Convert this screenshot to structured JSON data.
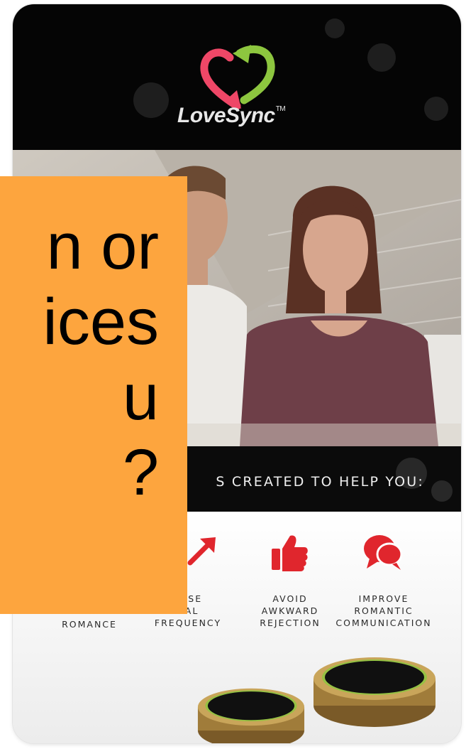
{
  "brand": {
    "name": "LoveSync",
    "trademark": "TM",
    "colors": {
      "pink": "#ef4767",
      "green": "#8dc63f",
      "red": "#e0262d",
      "overlay": "#fda53e"
    }
  },
  "photo": {
    "description_icon": "couple-photo"
  },
  "banner": {
    "text": "S CREATED TO HELP YOU:"
  },
  "benefits": [
    {
      "icon": "heart-icon",
      "label": "ROMANCE"
    },
    {
      "icon": "arrow-up-right-icon",
      "label": "EASE\nUAL\nFREQUENCY"
    },
    {
      "icon": "thumbs-up-icon",
      "label": "AVOID\nAWKWARD\nREJECTION"
    },
    {
      "icon": "chat-bubbles-icon",
      "label": "IMPROVE\nROMANTIC\nCOMMUNICATION"
    }
  ],
  "overlay": {
    "text": "n or\nices\nu\n?"
  }
}
